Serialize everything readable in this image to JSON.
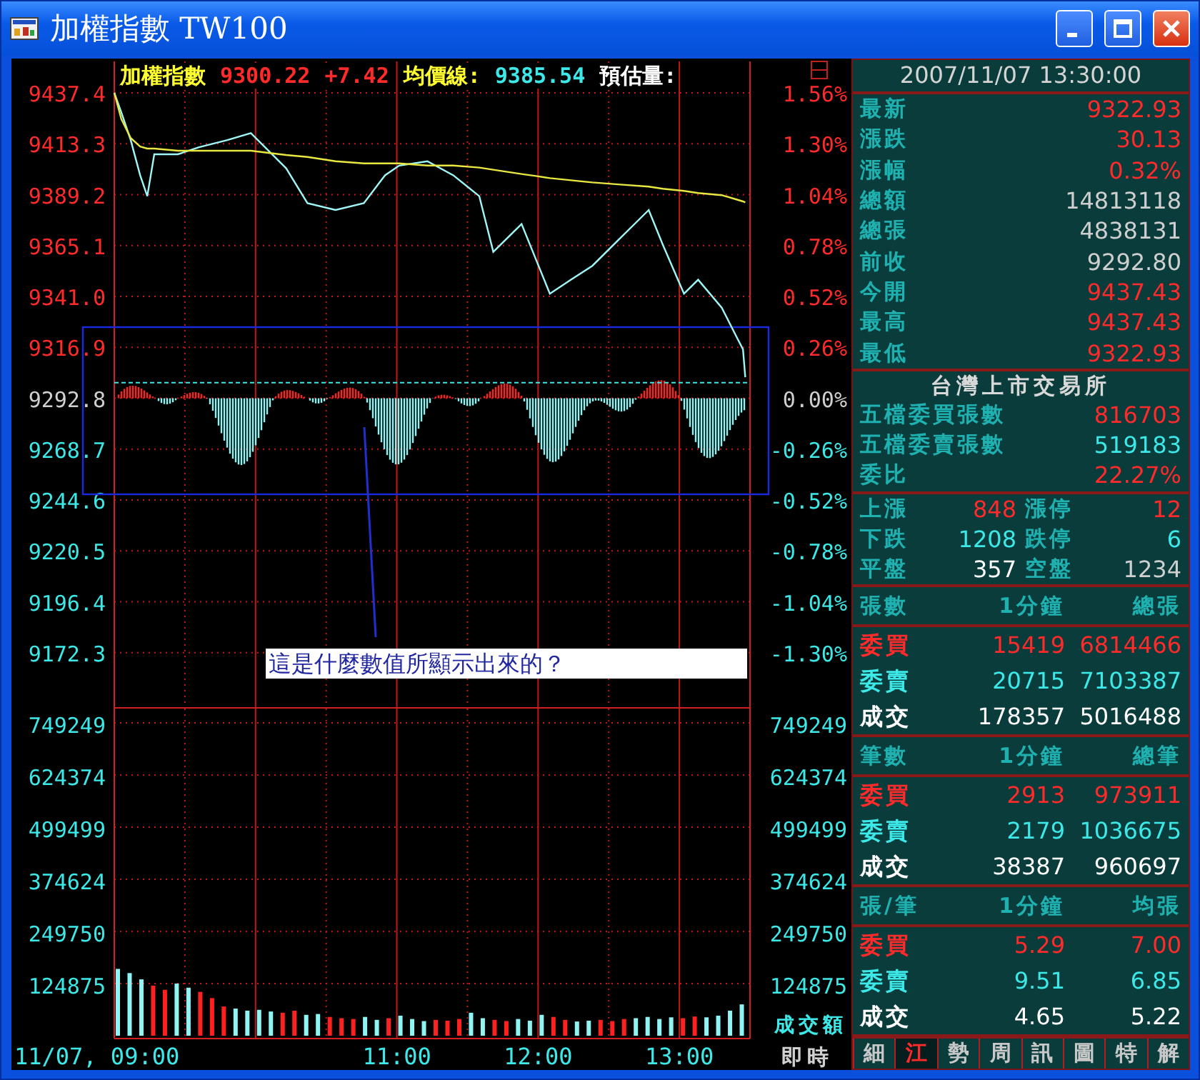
{
  "window": {
    "title": "加權指數 TW100"
  },
  "chart": {
    "header": [
      {
        "text": "加權指數",
        "color": "#ffff30"
      },
      {
        "text": "9300.22",
        "color": "#ff2a2a"
      },
      {
        "text": "+7.42",
        "color": "#ff2a2a"
      },
      {
        "text": "均價線:",
        "color": "#ffff30"
      },
      {
        "text": "9385.54",
        "color": "#3ce8e8"
      },
      {
        "text": "預估量:",
        "color": "#ffffff"
      }
    ],
    "percent_axis": [
      {
        "label": "1.56%",
        "color": "#ff2a2a"
      },
      {
        "label": "1.30%",
        "color": "#ff2a2a"
      },
      {
        "label": "1.04%",
        "color": "#ff2a2a"
      },
      {
        "label": "0.78%",
        "color": "#ff2a2a"
      },
      {
        "label": "0.52%",
        "color": "#ff2a2a"
      },
      {
        "label": "0.26%",
        "color": "#ff2a2a"
      },
      {
        "label": "0.00%",
        "color": "#cfcfcf"
      },
      {
        "label": "-0.26%",
        "color": "#3ce8e8"
      },
      {
        "label": "-0.52%",
        "color": "#3ce8e8"
      },
      {
        "label": "-0.78%",
        "color": "#3ce8e8"
      },
      {
        "label": "-1.04%",
        "color": "#3ce8e8"
      },
      {
        "label": "-1.30%",
        "color": "#3ce8e8"
      }
    ],
    "price": {
      "chart_data": {
        "type": "line",
        "grid": true,
        "ref_lines": [
          {
            "axis": "y",
            "value": 9300.2
          }
        ],
        "xlim": [
          9,
          13.5
        ],
        "ylim": [
          9146.2,
          9437.4
        ],
        "yticks": [
          {
            "value": 9437.4,
            "label": "9437.4"
          },
          {
            "value": 9413.3,
            "label": "9413.3"
          },
          {
            "value": 9389.2,
            "label": "9389.2"
          },
          {
            "value": 9365.1,
            "label": "9365.1"
          },
          {
            "value": 9341.0,
            "label": "9341.0"
          },
          {
            "value": 9316.9,
            "label": "9316.9"
          },
          {
            "value": 9292.8,
            "label": "9292.8"
          },
          {
            "value": 9268.7,
            "label": "9268.7"
          },
          {
            "value": 9244.6,
            "label": "9244.6"
          },
          {
            "value": 9220.5,
            "label": "9220.5"
          },
          {
            "value": 9196.4,
            "label": "9196.4"
          },
          {
            "value": 9172.3,
            "label": "9172.3"
          }
        ],
        "x": [
          9,
          9.05,
          9.1167,
          9.1833,
          9.2333,
          9.2833,
          9.45,
          9.6,
          9.8,
          9.9667,
          10.2167,
          10.3667,
          10.5667,
          10.7667,
          10.9167,
          11.0167,
          11.2167,
          11.4,
          11.5833,
          11.6833,
          11.7833,
          11.8833,
          11.9833,
          12.0833,
          12.2333,
          12.3833,
          12.5833,
          12.7833,
          12.8833,
          13.0333,
          13.1333,
          13.3,
          13.4,
          13.45,
          13.4667
        ],
        "series": [
          {
            "color": "#9ff6f6",
            "values": [
              9437.4,
              9428.2,
              9415.0,
              9398.4,
              9388.5,
              9408.3,
              9408.3,
              9411.6,
              9415.0,
              9418.3,
              9401.7,
              9385.2,
              9381.9,
              9385.2,
              9398.4,
              9403.0,
              9405.0,
              9398.4,
              9388.5,
              9362.1,
              9368.7,
              9375.3,
              9358.8,
              9342.3,
              9348.9,
              9355.5,
              9368.7,
              9381.9,
              9365.4,
              9342.3,
              9348.9,
              9335.7,
              9322.5,
              9315.9,
              9302.7
            ]
          },
          {
            "color": "#e8e840",
            "values": [
              9437.4,
              9425,
              9416,
              9412,
              9411,
              9411,
              9410,
              9410,
              9410,
              9410,
              9408,
              9407,
              9405,
              9404,
              9404,
              9404,
              9403,
              9403,
              9402,
              9401,
              9400,
              9399,
              9398,
              9397,
              9396,
              9395,
              9394,
              9393,
              9392,
              9391,
              9390,
              9389,
              9387,
              9386,
              9385.5
            ]
          }
        ]
      }
    },
    "annotation": {
      "note": "這是什麼數值所顯示出來的？"
    },
    "volume": {
      "unit_label": "成交額",
      "right_axis": [
        "749249",
        "624374",
        "499499",
        "374624",
        "249750",
        "124875"
      ],
      "chart_data": {
        "type": "bar",
        "grid": true,
        "xlim": [
          9,
          13.5
        ],
        "ylim": [
          0,
          749249
        ],
        "yticks": [
          {
            "value": 749249,
            "label": "749249"
          },
          {
            "value": 624374,
            "label": "624374"
          },
          {
            "value": 499499,
            "label": "499499"
          },
          {
            "value": 374624,
            "label": "374624"
          },
          {
            "value": 249750,
            "label": "249750"
          },
          {
            "value": 124875,
            "label": "124875"
          }
        ],
        "xticks": [
          {
            "value": 9,
            "label": "11/07, 09:00"
          },
          {
            "value": 11,
            "label": "11:00"
          },
          {
            "value": 12,
            "label": "12:00"
          },
          {
            "value": 13,
            "label": "13:00"
          }
        ],
        "x": [
          9,
          9.0833,
          9.1667,
          9.25,
          9.3333,
          9.4167,
          9.5,
          9.5833,
          9.6667,
          9.75,
          9.8333,
          9.9167,
          10,
          10.0833,
          10.1667,
          10.25,
          10.3333,
          10.4167,
          10.5,
          10.5833,
          10.6667,
          10.75,
          10.8333,
          10.9167,
          11,
          11.0833,
          11.1667,
          11.25,
          11.3333,
          11.4167,
          11.5,
          11.5833,
          11.6667,
          11.75,
          11.8333,
          11.9167,
          12,
          12.0833,
          12.1667,
          12.25,
          12.3333,
          12.4167,
          12.5,
          12.5833,
          12.6667,
          12.75,
          12.8333,
          12.9167,
          13,
          13.0833,
          13.1667,
          13.25,
          13.3333,
          13.4167
        ],
        "series": [
          {
            "color": "#ff2020",
            "values": [
              null,
              null,
              null,
              120000,
              110000,
              null,
              null,
              105000,
              90000,
              70000,
              null,
              null,
              null,
              null,
              55000,
              60000,
              null,
              null,
              45000,
              42000,
              40000,
              null,
              null,
              42000,
              null,
              null,
              null,
              38000,
              36000,
              40000,
              null,
              null,
              38000,
              35000,
              null,
              null,
              null,
              45000,
              38000,
              null,
              null,
              38000,
              35000,
              40000,
              null,
              null,
              null,
              null,
              42000,
              46000,
              null,
              null,
              null,
              null
            ]
          },
          {
            "color": "#8ff4f4",
            "values": [
              160000,
              150000,
              135000,
              null,
              null,
              125000,
              115000,
              null,
              null,
              null,
              65000,
              60000,
              62000,
              58000,
              null,
              null,
              50000,
              52000,
              null,
              null,
              null,
              45000,
              38000,
              null,
              48000,
              40000,
              35000,
              null,
              null,
              null,
              55000,
              42000,
              null,
              null,
              40000,
              36000,
              50000,
              null,
              null,
              34000,
              36000,
              null,
              null,
              null,
              42000,
              45000,
              40000,
              44000,
              null,
              null,
              44000,
              48000,
              60000,
              75000
            ]
          }
        ]
      }
    },
    "mode_button": "即時"
  },
  "panel": {
    "datetime": "2007/11/07 13:30:00",
    "quotes": [
      {
        "label": "最新",
        "value": "9322.93",
        "color": "#ff2a2a"
      },
      {
        "label": "漲跌",
        "value": "30.13",
        "color": "#ff2a2a"
      },
      {
        "label": "漲幅",
        "value": "0.32%",
        "color": "#ff2a2a"
      },
      {
        "label": "總額",
        "value": "14813118",
        "color": "#cfcfcf"
      },
      {
        "label": "總張",
        "value": "4838131",
        "color": "#cfcfcf"
      },
      {
        "label": "前收",
        "value": "9292.80",
        "color": "#cfcfcf"
      },
      {
        "label": "今開",
        "value": "9437.43",
        "color": "#ff2a2a"
      },
      {
        "label": "最高",
        "value": "9437.43",
        "color": "#ff2a2a"
      },
      {
        "label": "最低",
        "value": "9322.93",
        "color": "#ff2a2a"
      }
    ],
    "exchange": {
      "title": "台灣上市交易所",
      "rows": [
        {
          "label": "五檔委買張數",
          "value": "816703",
          "color": "#ff2a2a"
        },
        {
          "label": "五檔委賣張數",
          "value": "519183",
          "color": "#3ce8e8"
        },
        {
          "label": "委比",
          "value": "22.27%",
          "color": "#ff2a2a"
        }
      ]
    },
    "breadth": [
      {
        "label": "上漲",
        "value": "848",
        "color": "#ff2a2a"
      },
      {
        "label": "漲停",
        "value": "12",
        "color": "#ff2a2a"
      },
      {
        "label": "下跌",
        "value": "1208",
        "color": "#3ce8e8"
      },
      {
        "label": "跌停",
        "value": "6",
        "color": "#3ce8e8"
      },
      {
        "label": "平盤",
        "value": "357",
        "color": "#ffffff"
      },
      {
        "label": "空盤",
        "value": "1234",
        "color": "#cfcfcf"
      }
    ],
    "tables": [
      {
        "columns": [
          "張數",
          "1分鐘",
          "總張"
        ],
        "rows": [
          {
            "label": "委買",
            "minute": "15419",
            "total": "6814466",
            "color": "#ff2a2a"
          },
          {
            "label": "委賣",
            "minute": "20715",
            "total": "7103387",
            "color": "#3ce8e8"
          },
          {
            "label": "成交",
            "minute": "178357",
            "total": "5016488",
            "color": "#ffffff"
          }
        ]
      },
      {
        "columns": [
          "筆數",
          "1分鐘",
          "總筆"
        ],
        "rows": [
          {
            "label": "委買",
            "minute": "2913",
            "total": "973911",
            "color": "#ff2a2a"
          },
          {
            "label": "委賣",
            "minute": "2179",
            "total": "1036675",
            "color": "#3ce8e8"
          },
          {
            "label": "成交",
            "minute": "38387",
            "total": "960697",
            "color": "#ffffff"
          }
        ]
      },
      {
        "columns": [
          "張/筆",
          "1分鐘",
          "均張"
        ],
        "rows": [
          {
            "label": "委買",
            "minute": "5.29",
            "total": "7.00",
            "color": "#ff2a2a"
          },
          {
            "label": "委賣",
            "minute": "9.51",
            "total": "6.85",
            "color": "#3ce8e8"
          },
          {
            "label": "成交",
            "minute": "4.65",
            "total": "5.22",
            "color": "#ffffff"
          }
        ]
      }
    ],
    "tabs": [
      {
        "label": "細",
        "selected": false
      },
      {
        "label": "江",
        "selected": true
      },
      {
        "label": "勢",
        "selected": false
      },
      {
        "label": "周",
        "selected": false
      },
      {
        "label": "訊",
        "selected": false
      },
      {
        "label": "圖",
        "selected": false
      },
      {
        "label": "特",
        "selected": false
      },
      {
        "label": "解",
        "selected": false
      }
    ]
  }
}
